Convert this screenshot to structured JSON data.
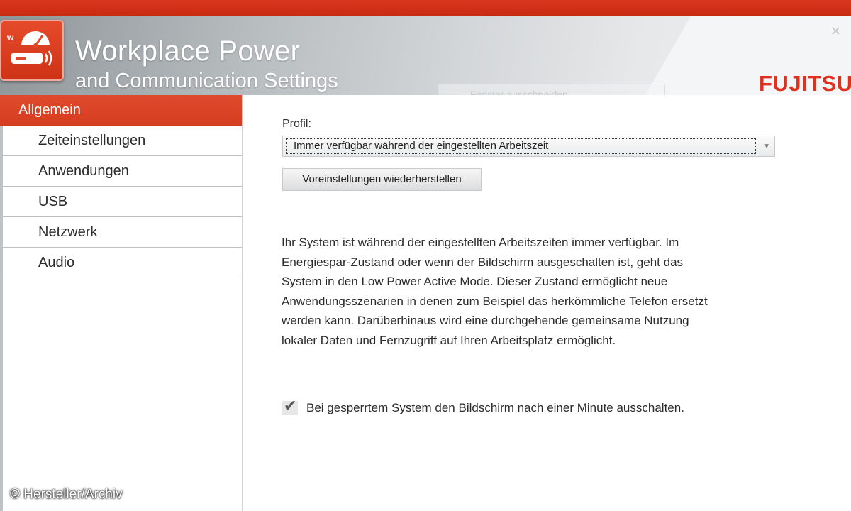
{
  "app": {
    "title": "Workplace Power",
    "subtitle": "and Communication Settings",
    "brand": "FUJITSU",
    "logo_letter": "w",
    "ghost_label": "Fenster ausschneiden"
  },
  "sidebar": {
    "items": [
      {
        "label": "Allgemein",
        "active": true
      },
      {
        "label": "Zeiteinstellungen"
      },
      {
        "label": "Anwendungen"
      },
      {
        "label": "USB"
      },
      {
        "label": "Netzwerk"
      },
      {
        "label": "Audio"
      }
    ]
  },
  "main": {
    "profile_label": "Profil:",
    "profile_value": "Immer verfügbar während der eingestellten  Arbeitszeit",
    "reset_label": "Voreinstellungen wiederherstellen",
    "description": [
      "Ihr System ist während der eingestellten Arbeitszeiten immer verfügbar. Im",
      "Energiespar-Zustand oder wenn der Bildschirm ausgeschalten ist, geht das",
      "System in den Low Power Active Mode. Dieser Zustand ermöglicht neue",
      "Anwendungsszenarien in denen zum Beispiel das herkömmliche Telefon ersetzt",
      "werden kann. Darüberhinaus wird eine durchgehende gemeinsame Nutzung",
      "lokaler Daten und Fernzugriff auf Ihren Arbeitsplatz ermöglicht."
    ],
    "checkbox_label": "Bei gesperrtem System den Bildschirm nach einer Minute ausschalten.",
    "checkbox_checked": true
  },
  "credit": "© Hersteller/Archiv",
  "colors": {
    "accent": "#d9381d",
    "brand_red": "#e0301e"
  }
}
